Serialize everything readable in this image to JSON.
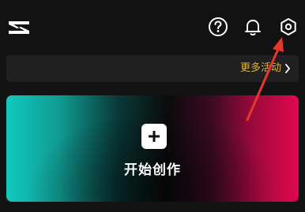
{
  "topbar": {
    "logo_icon": "capcut-logo-icon",
    "help_icon": "help-icon",
    "notifications_icon": "bell-icon",
    "settings_icon": "settings-gear-icon"
  },
  "banner": {
    "more_label": "更多活动"
  },
  "create": {
    "label": "开始创作",
    "icon": "plus-icon"
  },
  "annotation": {
    "color": "#e8362a",
    "target": "settings-gear-icon"
  },
  "colors": {
    "background": "#121212",
    "accent_gold": "#e2b23a",
    "gradient_left": "#11c9c0",
    "gradient_right": "#e0074e"
  }
}
